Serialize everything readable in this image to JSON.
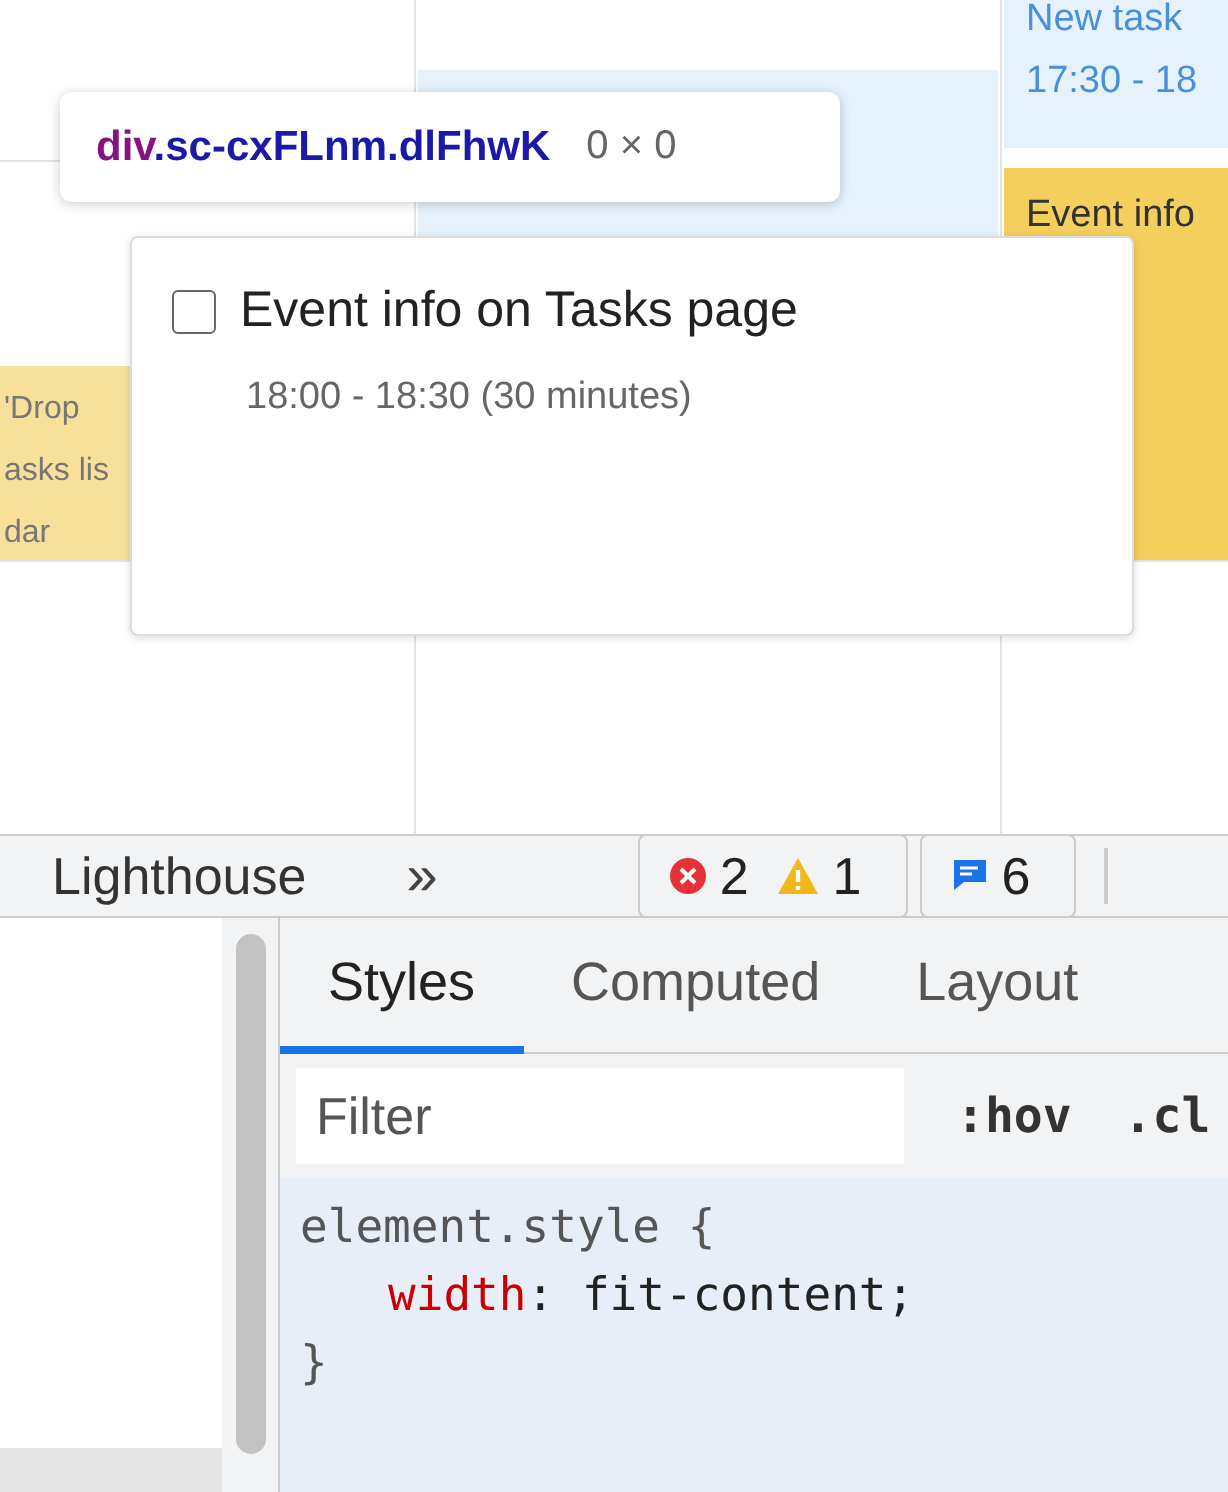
{
  "calendar": {
    "events": [
      {
        "kind": "task",
        "lines": [
          "New task",
          "17:30 - 18"
        ]
      },
      {
        "kind": "event",
        "lines": [
          "Event info"
        ]
      },
      {
        "kind": "event",
        "lines": [
          "'Drop",
          "asks lis",
          "dar"
        ]
      }
    ]
  },
  "inspector_tooltip": {
    "tag": "div",
    "classes": ".sc-cxFLnm.dlFhwK",
    "size": "0 × 0"
  },
  "event_popup": {
    "checked": false,
    "title": "Event info on Tasks page",
    "time": "18:00 - 18:30 (30 minutes)"
  },
  "devtools": {
    "toolbar": {
      "tab": "Lighthouse",
      "more": "»",
      "errors": "2",
      "warnings": "1",
      "messages": "6"
    },
    "tabs": [
      {
        "label": "Styles",
        "selected": true
      },
      {
        "label": "Computed",
        "selected": false
      },
      {
        "label": "Layout",
        "selected": false
      }
    ],
    "filter": {
      "placeholder": "Filter"
    },
    "buttons": [
      ":hov",
      ".cl"
    ],
    "rule": {
      "selector": "element.style {",
      "property": "width",
      "separator": ":",
      "value": "fit-content;",
      "close": "}"
    }
  }
}
